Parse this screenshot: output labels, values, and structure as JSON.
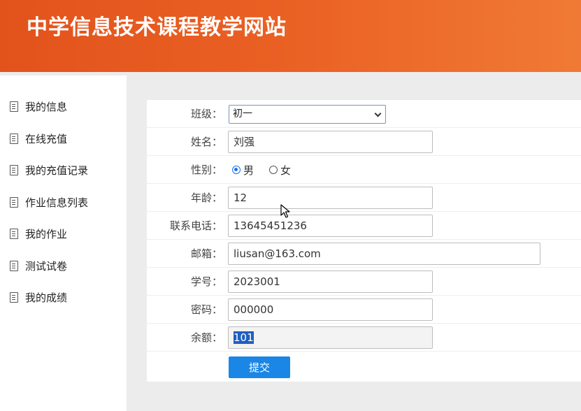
{
  "header": {
    "title": "中学信息技术课程教学网站"
  },
  "sidebar": {
    "items": [
      {
        "label": "我的信息"
      },
      {
        "label": "在线充值"
      },
      {
        "label": "我的充值记录"
      },
      {
        "label": "作业信息列表"
      },
      {
        "label": "我的作业"
      },
      {
        "label": "测试试卷"
      },
      {
        "label": "我的成绩"
      }
    ]
  },
  "form": {
    "class": {
      "label": "班级：",
      "value": "初一"
    },
    "name": {
      "label": "姓名：",
      "value": "刘强"
    },
    "gender": {
      "label": "性别：",
      "options": [
        "男",
        "女"
      ],
      "selected": "男"
    },
    "age": {
      "label": "年龄：",
      "value": "12"
    },
    "phone": {
      "label": "联系电话：",
      "value": "13645451236"
    },
    "email": {
      "label": "邮箱：",
      "value": "liusan@163.com"
    },
    "student_id": {
      "label": "学号：",
      "value": "2023001"
    },
    "password": {
      "label": "密码：",
      "value": "000000"
    },
    "balance": {
      "label": "余额：",
      "value": "101"
    },
    "submit_label": "提交"
  },
  "colors": {
    "header": "#e8591f",
    "accent": "#1a86e6"
  }
}
